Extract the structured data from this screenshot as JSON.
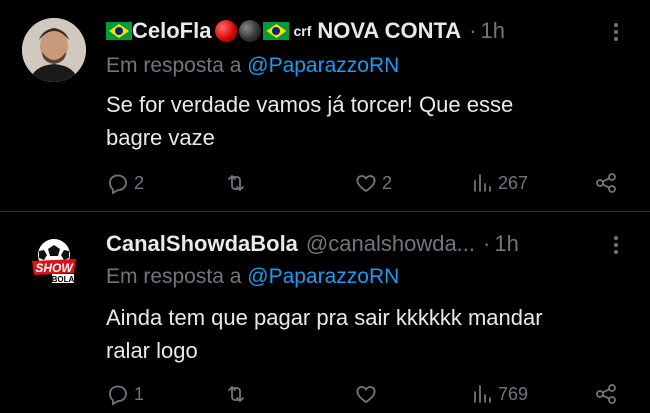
{
  "tweets": [
    {
      "display_name": "CeloFla",
      "crf": "crf",
      "name_suffix": "NOVA CONTA",
      "handle": "",
      "time": "1h",
      "reply_prefix": "Em resposta a",
      "reply_to": "@PaparazzoRN",
      "text_line1": "Se for verdade vamos já torcer! Que esse",
      "text_line2": "bagre vaze",
      "replies": "2",
      "retweets": "",
      "likes": "2",
      "views": "267"
    },
    {
      "display_name": "CanalShowdaBola",
      "handle": "@canalshowda...",
      "time": "1h",
      "avatar_text_top": "SHOW",
      "avatar_text_bottom": "BOLA",
      "reply_prefix": "Em resposta a",
      "reply_to": "@PaparazzoRN",
      "text_line1": "Ainda tem que pagar pra sair kkkkkk mandar",
      "text_line2": "ralar logo",
      "replies": "1",
      "retweets": "",
      "likes": "",
      "views": "769"
    }
  ],
  "colors": {
    "background": "#000000",
    "text": "#e7e9ea",
    "muted": "#71767b",
    "link": "#1d9bf0",
    "divider": "#2f3336"
  },
  "icons": [
    "reply-icon",
    "retweet-icon",
    "like-icon",
    "views-icon",
    "share-icon",
    "more-icon"
  ]
}
